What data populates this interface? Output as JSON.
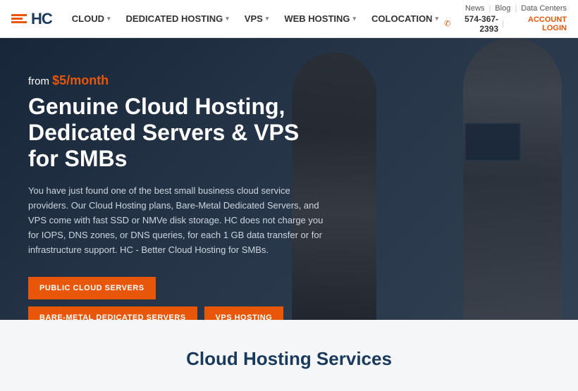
{
  "topbar": {
    "logo_text": "HC",
    "nav_items": [
      {
        "label": "CLOUD",
        "has_arrow": true
      },
      {
        "label": "DEDICATED HOSTING",
        "has_arrow": true
      },
      {
        "label": "VPS",
        "has_arrow": true
      },
      {
        "label": "WEB HOSTING",
        "has_arrow": true
      },
      {
        "label": "COLOCATION",
        "has_arrow": true
      }
    ],
    "top_links": [
      "News",
      "Blog",
      "Data Centers"
    ],
    "phone": "574-367-2393",
    "account_login": "ACCOUNT LOGIN"
  },
  "hero": {
    "from_label": "from ",
    "price": "$5/month",
    "title": "Genuine Cloud Hosting, Dedicated Servers & VPS for SMBs",
    "description": "You have just found one of the best small business cloud service providers. Our Cloud Hosting plans, Bare-Metal Dedicated Servers, and VPS come with fast SSD or NMVe disk storage. HC does not charge you for IOPS, DNS zones, or DNS queries, for each 1 GB data transfer or for infrastructure support. HC - Better Cloud Hosting for SMBs.",
    "btn1": "PUBLIC CLOUD SERVERS",
    "btn2": "BARE-METAL DEDICATED SERVERS",
    "btn3": "VPS HOSTING"
  },
  "bottom": {
    "title": "Cloud Hosting Services"
  }
}
